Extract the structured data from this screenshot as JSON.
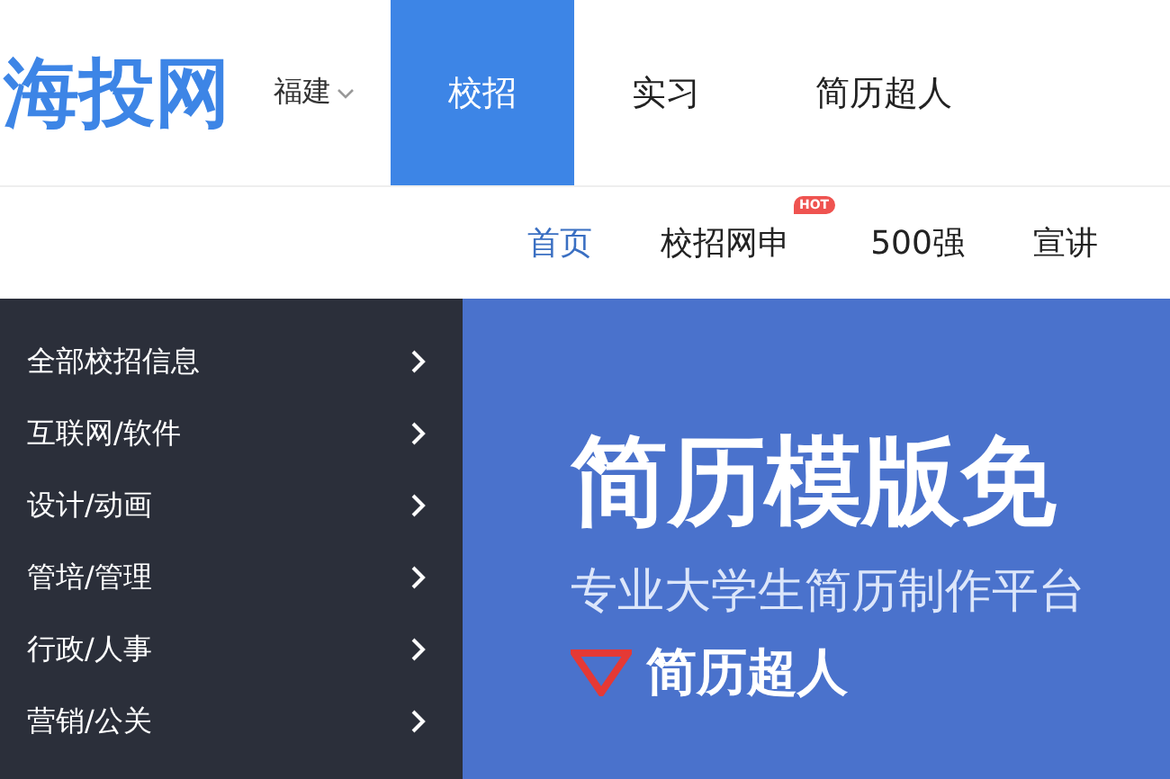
{
  "header": {
    "logo": "海投网",
    "city": "福建",
    "tabs": [
      {
        "label": "校招",
        "selected": true
      },
      {
        "label": "实习",
        "selected": false
      },
      {
        "label": "简历超人",
        "selected": false
      }
    ]
  },
  "subnav": [
    {
      "label": "首页",
      "selected": true
    },
    {
      "label": "校招网申",
      "selected": false,
      "badge": "HOT"
    },
    {
      "label": "500强",
      "selected": false
    },
    {
      "label": "宣讲",
      "selected": false
    }
  ],
  "sidebar": {
    "items": [
      "全部校招信息",
      "互联网/软件",
      "设计/动画",
      "管培/管理",
      "行政/人事",
      "营销/公关"
    ]
  },
  "banner": {
    "title": "简历模版免",
    "subtitle": "专业大学生简历制作平台",
    "brand": "简历超人"
  }
}
